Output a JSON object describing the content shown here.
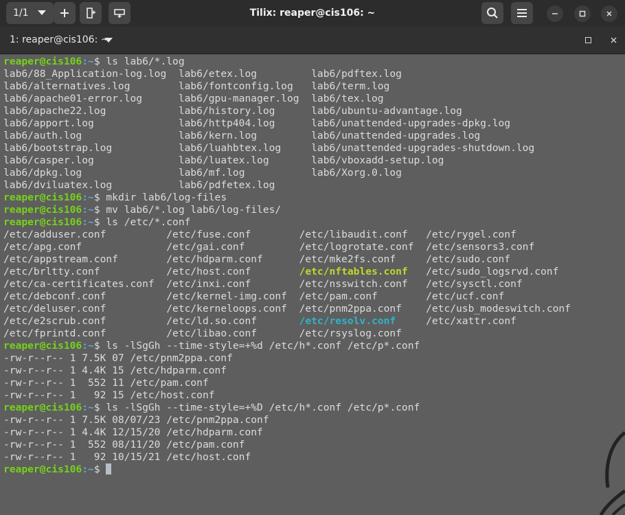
{
  "titlebar": {
    "tab_counter": "1/1",
    "title": "Tilix: reaper@cis106: ~"
  },
  "tab": {
    "title": "1: reaper@cis106: ~"
  },
  "prompt": {
    "user_host": "reaper@cis106",
    "path": ":~",
    "sign": "$ "
  },
  "colors": {
    "prompt_user": "#76d11a",
    "prompt_path": "#6d9fd9",
    "term_bg": "#5e5e5e",
    "link_yellow": "#c2d52a",
    "link_cyan": "#2fb3c9"
  },
  "commands": [
    "ls lab6/*.log",
    "mkdir lab6/log-files",
    "mv lab6/*.log lab6/log-files/",
    "ls /etc/*.conf",
    "ls -lSgGh --time-style=+%d /etc/h*.conf /etc/p*.conf",
    "ls -lSgGh --time-style=+%D /etc/h*.conf /etc/p*.conf"
  ],
  "log_listing": [
    [
      "lab6/88_Application-log.log",
      "lab6/etex.log",
      "lab6/pdftex.log"
    ],
    [
      "lab6/alternatives.log",
      "lab6/fontconfig.log",
      "lab6/term.log"
    ],
    [
      "lab6/apache01-error.log",
      "lab6/gpu-manager.log",
      "lab6/tex.log"
    ],
    [
      "lab6/apache22.log",
      "lab6/history.log",
      "lab6/ubuntu-advantage.log"
    ],
    [
      "lab6/apport.log",
      "lab6/http404.log",
      "lab6/unattended-upgrades-dpkg.log"
    ],
    [
      "lab6/auth.log",
      "lab6/kern.log",
      "lab6/unattended-upgrades.log"
    ],
    [
      "lab6/bootstrap.log",
      "lab6/luahbtex.log",
      "lab6/unattended-upgrades-shutdown.log"
    ],
    [
      "lab6/casper.log",
      "lab6/luatex.log",
      "lab6/vboxadd-setup.log"
    ],
    [
      "lab6/dpkg.log",
      "lab6/mf.log",
      "lab6/Xorg.0.log"
    ],
    [
      "lab6/dviluatex.log",
      "lab6/pdfetex.log",
      ""
    ]
  ],
  "conf_listing": [
    [
      "/etc/adduser.conf",
      "/etc/fuse.conf",
      "/etc/libaudit.conf",
      "/etc/rygel.conf"
    ],
    [
      "/etc/apg.conf",
      "/etc/gai.conf",
      "/etc/logrotate.conf",
      "/etc/sensors3.conf"
    ],
    [
      "/etc/appstream.conf",
      "/etc/hdparm.conf",
      "/etc/mke2fs.conf",
      "/etc/sudo.conf"
    ],
    [
      "/etc/brltty.conf",
      "/etc/host.conf",
      "/etc/nftables.conf",
      "/etc/sudo_logsrvd.conf"
    ],
    [
      "/etc/ca-certificates.conf",
      "/etc/inxi.conf",
      "/etc/nsswitch.conf",
      "/etc/sysctl.conf"
    ],
    [
      "/etc/debconf.conf",
      "/etc/kernel-img.conf",
      "/etc/pam.conf",
      "/etc/ucf.conf"
    ],
    [
      "/etc/deluser.conf",
      "/etc/kerneloops.conf",
      "/etc/pnm2ppa.conf",
      "/etc/usb_modeswitch.conf"
    ],
    [
      "/etc/e2scrub.conf",
      "/etc/ld.so.conf",
      "/etc/resolv.conf",
      "/etc/xattr.conf"
    ],
    [
      "/etc/fprintd.conf",
      "/etc/libao.conf",
      "/etc/rsyslog.conf",
      ""
    ]
  ],
  "highlighted": {
    "yellow": "/etc/nftables.conf",
    "cyan": "/etc/resolv.conf"
  },
  "long_listing_d": [
    "-rw-r--r-- 1 7.5K 07 /etc/pnm2ppa.conf",
    "-rw-r--r-- 1 4.4K 15 /etc/hdparm.conf",
    "-rw-r--r-- 1  552 11 /etc/pam.conf",
    "-rw-r--r-- 1   92 15 /etc/host.conf"
  ],
  "long_listing_D": [
    "-rw-r--r-- 1 7.5K 08/07/23 /etc/pnm2ppa.conf",
    "-rw-r--r-- 1 4.4K 12/15/20 /etc/hdparm.conf",
    "-rw-r--r-- 1  552 08/11/20 /etc/pam.conf",
    "-rw-r--r-- 1   92 10/15/21 /etc/host.conf"
  ]
}
